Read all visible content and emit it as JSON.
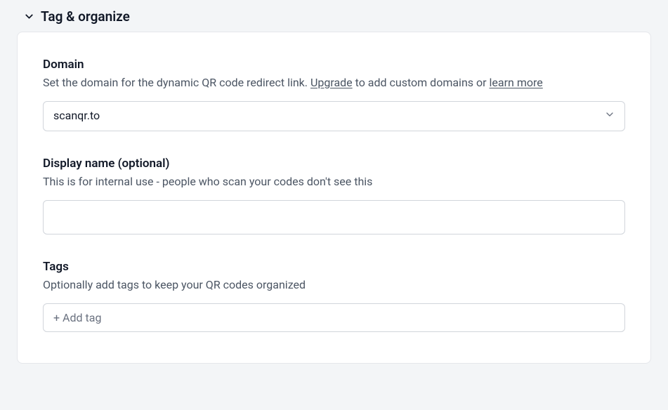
{
  "section": {
    "title": "Tag & organize"
  },
  "domain": {
    "label": "Domain",
    "desc_pre": "Set the domain for the dynamic QR code redirect link. ",
    "upgrade_link": "Upgrade",
    "desc_mid": " to add custom domains or ",
    "learn_link": "learn more",
    "selected": "scanqr.to"
  },
  "displayName": {
    "label": "Display name (optional)",
    "desc": "This is for internal use - people who scan your codes don't see this",
    "value": ""
  },
  "tags": {
    "label": "Tags",
    "desc": "Optionally add tags to keep your QR codes organized",
    "placeholder": "+ Add tag"
  }
}
